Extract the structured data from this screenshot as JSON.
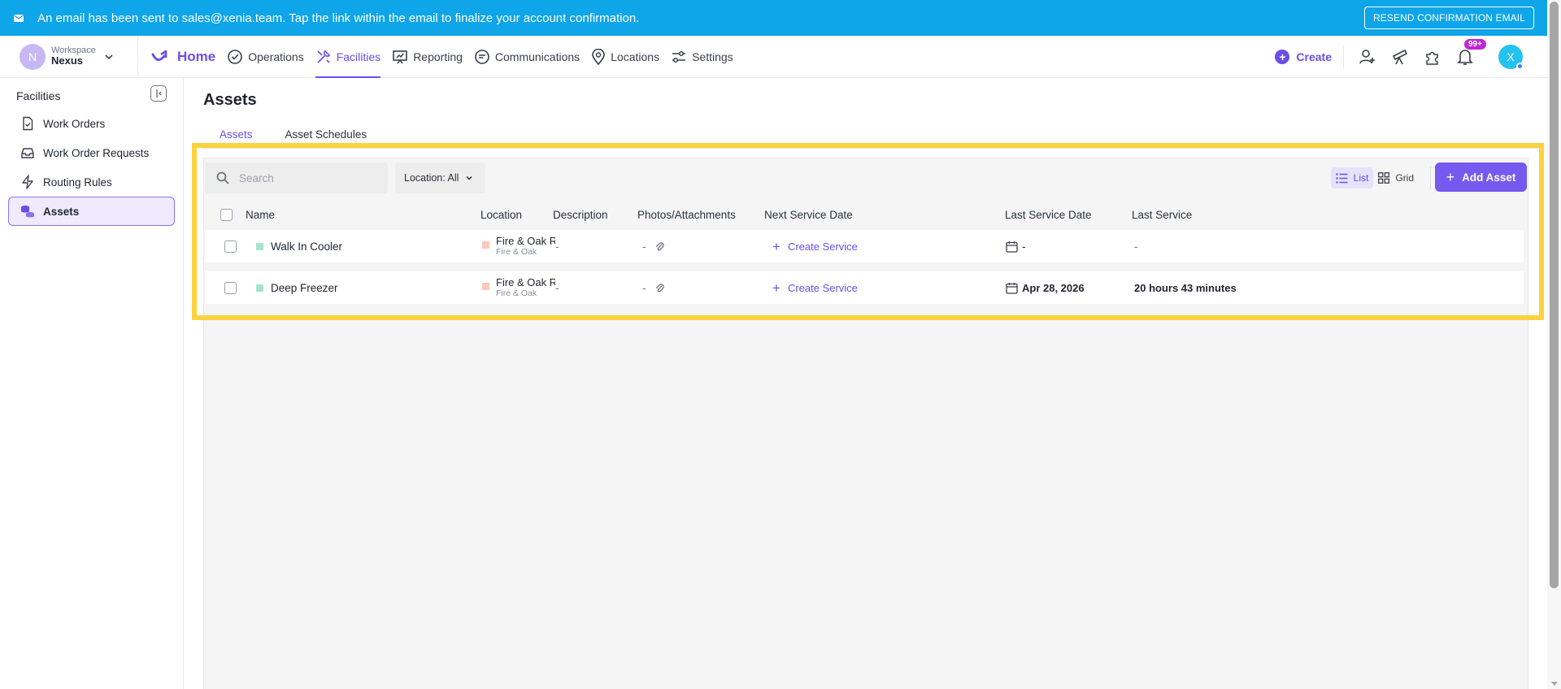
{
  "banner": {
    "message": "An email has been sent to sales@xenia.team. Tap the link within the email to finalize your account confirmation.",
    "resend_label": "RESEND CONFIRMATION EMAIL"
  },
  "workspace": {
    "initial": "N",
    "label": "Workspace",
    "name": "Nexus"
  },
  "nav": {
    "home": "Home",
    "items": [
      "Operations",
      "Facilities",
      "Reporting",
      "Communications",
      "Locations",
      "Settings"
    ],
    "active": "Facilities",
    "create_label": "Create",
    "notification_badge": "99+",
    "user_initial": "X"
  },
  "sidebar": {
    "title": "Facilities",
    "items": [
      {
        "label": "Work Orders",
        "icon": "work-order-icon"
      },
      {
        "label": "Work Order Requests",
        "icon": "inbox-icon"
      },
      {
        "label": "Routing Rules",
        "icon": "lightning-icon"
      },
      {
        "label": "Assets",
        "icon": "assets-icon",
        "active": true
      }
    ]
  },
  "page": {
    "title": "Assets",
    "tabs": [
      "Assets",
      "Asset Schedules"
    ],
    "active_tab": "Assets"
  },
  "toolbar": {
    "search_placeholder": "Search",
    "location_filter": "Location: All",
    "view_list": "List",
    "view_grid": "Grid",
    "active_view": "List",
    "add_asset": "Add Asset"
  },
  "table": {
    "columns": [
      "Name",
      "Location",
      "Description",
      "Photos/Attachments",
      "Next Service Date",
      "Last Service Date",
      "Last Service"
    ],
    "rows": [
      {
        "name": "Walk In Cooler",
        "location": "Fire & Oak Re",
        "location_sub": "Fire & Oak",
        "description": "-",
        "photos": "-",
        "next_service": "Create Service",
        "last_service_date": "-",
        "last_service": "-"
      },
      {
        "name": "Deep Freezer",
        "location": "Fire & Oak Re",
        "location_sub": "Fire & Oak",
        "description": "-",
        "photos": "-",
        "next_service": "Create Service",
        "last_service_date": "Apr 28, 2026",
        "last_service": "20 hours 43 minutes"
      }
    ]
  },
  "colors": {
    "banner": "#0ea5e9",
    "accent": "#6b4ee6",
    "highlight": "#fdd23e",
    "asset_marker": "#a7e3cf",
    "location_marker": "#fbc9b8"
  }
}
